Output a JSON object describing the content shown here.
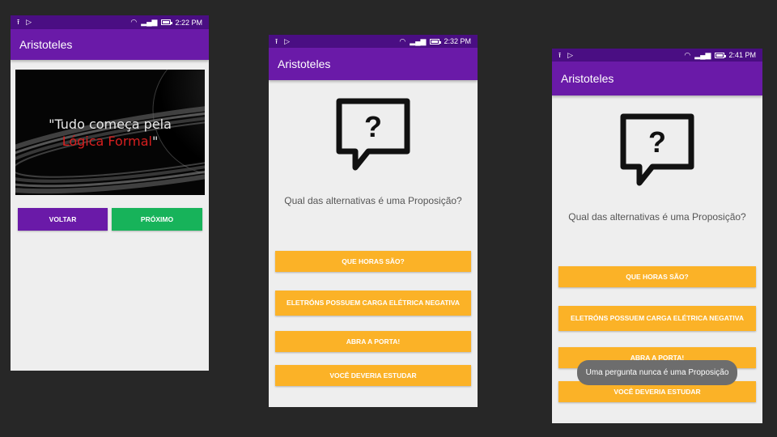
{
  "screens": [
    {
      "status_time": "2:22 PM",
      "app_title": "Aristoteles",
      "hero": {
        "quote_open": "\"Tudo começa pela",
        "quote_red": "Lógica Formal",
        "quote_close": "\""
      },
      "buttons": {
        "back": "VOLTAR",
        "next": "PRÓXIMO"
      }
    },
    {
      "status_time": "2:32 PM",
      "app_title": "Aristoteles",
      "question": "Qual das alternativas é uma Proposição?",
      "options": [
        "QUE HORAS SÃO?",
        "ELETRÓNS POSSUEM CARGA ELÉTRICA NEGATIVA",
        "ABRA A PORTA!",
        "VOCÊ DEVERIA ESTUDAR"
      ]
    },
    {
      "status_time": "2:41 PM",
      "app_title": "Aristoteles",
      "question": "Qual das alternativas é uma Proposição?",
      "options": [
        "QUE HORAS SÃO?",
        "ELETRÓNS POSSUEM CARGA ELÉTRICA NEGATIVA",
        "ABRA A PORTA!",
        "VOCÊ DEVERIA ESTUDAR"
      ],
      "toast": "Uma pergunta nunca é uma Proposição"
    }
  ],
  "colors": {
    "background": "#272727",
    "status_bar": "#4a0e83",
    "app_bar": "#6a1aa8",
    "option_button": "#fbb227",
    "next_button": "#17b35a",
    "back_button": "#6a1aa8",
    "screen_bg": "#eeeeee",
    "toast": "#6d6d6d"
  },
  "icons": [
    "upload-icon",
    "play-store-icon",
    "wifi-icon",
    "signal-icon",
    "battery-icon",
    "question-bubble-icon"
  ]
}
